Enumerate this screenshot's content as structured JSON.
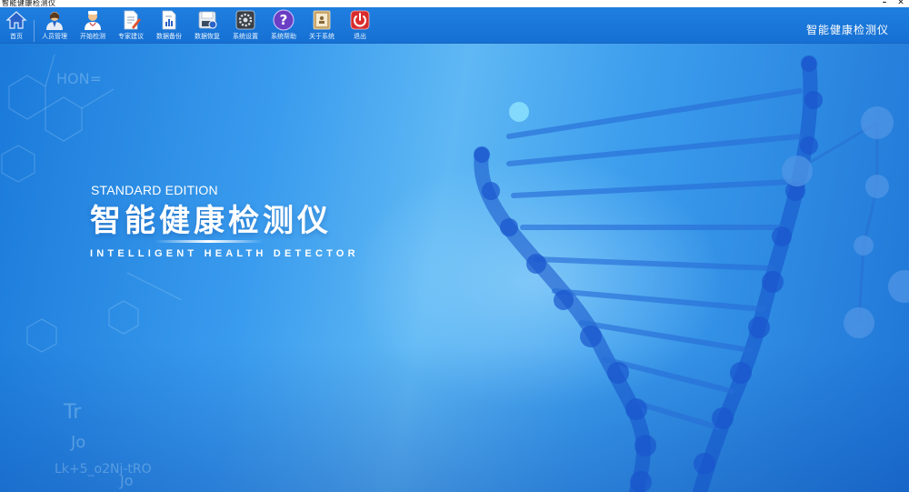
{
  "window": {
    "title": "智能健康检测仪",
    "controls": {
      "minimize": "–",
      "close": "✕"
    }
  },
  "toolbar": {
    "items": [
      {
        "id": "home",
        "label": "首页",
        "icon": "home-icon"
      },
      {
        "id": "staff",
        "label": "人员管理",
        "icon": "person-icon"
      },
      {
        "id": "start-test",
        "label": "开始检测",
        "icon": "doctor-icon"
      },
      {
        "id": "expert-advice",
        "label": "专家建议",
        "icon": "document-pen-icon"
      },
      {
        "id": "backup",
        "label": "数据备份",
        "icon": "document-chart-icon"
      },
      {
        "id": "restore",
        "label": "数据恢复",
        "icon": "disk-icon"
      },
      {
        "id": "settings",
        "label": "系统设置",
        "icon": "gear-icon"
      },
      {
        "id": "help",
        "label": "系统帮助",
        "icon": "help-icon"
      },
      {
        "id": "about",
        "label": "关于系统",
        "icon": "info-card-icon"
      },
      {
        "id": "exit",
        "label": "退出",
        "icon": "power-icon"
      }
    ],
    "app_name": "智能健康检测仪"
  },
  "hero": {
    "edition": "STANDARD EDITION",
    "headline": "智能健康检测仪",
    "subline": "INTELLIGENT HEALTH DETECTOR"
  },
  "colors": {
    "toolbar": "#1a77da",
    "background": "#3a9cee",
    "dna": "#1c5fcf"
  }
}
